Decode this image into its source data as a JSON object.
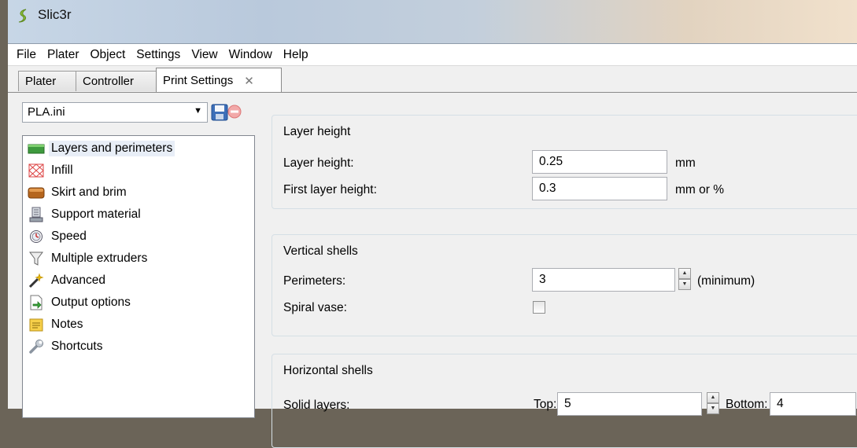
{
  "window": {
    "title": "Slic3r"
  },
  "menu": [
    "File",
    "Plater",
    "Object",
    "Settings",
    "View",
    "Window",
    "Help"
  ],
  "tabs": [
    {
      "label": "Plater"
    },
    {
      "label": "Controller"
    },
    {
      "label": "Print Settings",
      "close": "✕"
    }
  ],
  "preset": {
    "selected": "PLA.ini"
  },
  "sidebar": {
    "items": [
      {
        "label": "Layers and perimeters",
        "icon": "layers-icon"
      },
      {
        "label": "Infill",
        "icon": "infill-icon"
      },
      {
        "label": "Skirt and brim",
        "icon": "skirt-icon"
      },
      {
        "label": "Support material",
        "icon": "support-icon"
      },
      {
        "label": "Speed",
        "icon": "speed-icon"
      },
      {
        "label": "Multiple extruders",
        "icon": "funnel-icon"
      },
      {
        "label": "Advanced",
        "icon": "wand-icon"
      },
      {
        "label": "Output options",
        "icon": "output-icon"
      },
      {
        "label": "Notes",
        "icon": "notes-icon"
      },
      {
        "label": "Shortcuts",
        "icon": "wrench-icon"
      }
    ]
  },
  "layer_height": {
    "title": "Layer height",
    "layer_height_label": "Layer height:",
    "layer_height_value": "0.25",
    "layer_height_unit": "mm",
    "first_layer_label": "First layer height:",
    "first_layer_value": "0.3",
    "first_layer_unit": "mm or %"
  },
  "vertical_shells": {
    "title": "Vertical shells",
    "perimeters_label": "Perimeters:",
    "perimeters_value": "3",
    "perimeters_unit": "(minimum)",
    "spiral_label": "Spiral vase:",
    "spiral_checked": false
  },
  "horizontal_shells": {
    "title": "Horizontal shells",
    "solid_label": "Solid layers:",
    "top_label": "Top:",
    "top_value": "5",
    "bottom_label": "Bottom:",
    "bottom_value": "4"
  }
}
